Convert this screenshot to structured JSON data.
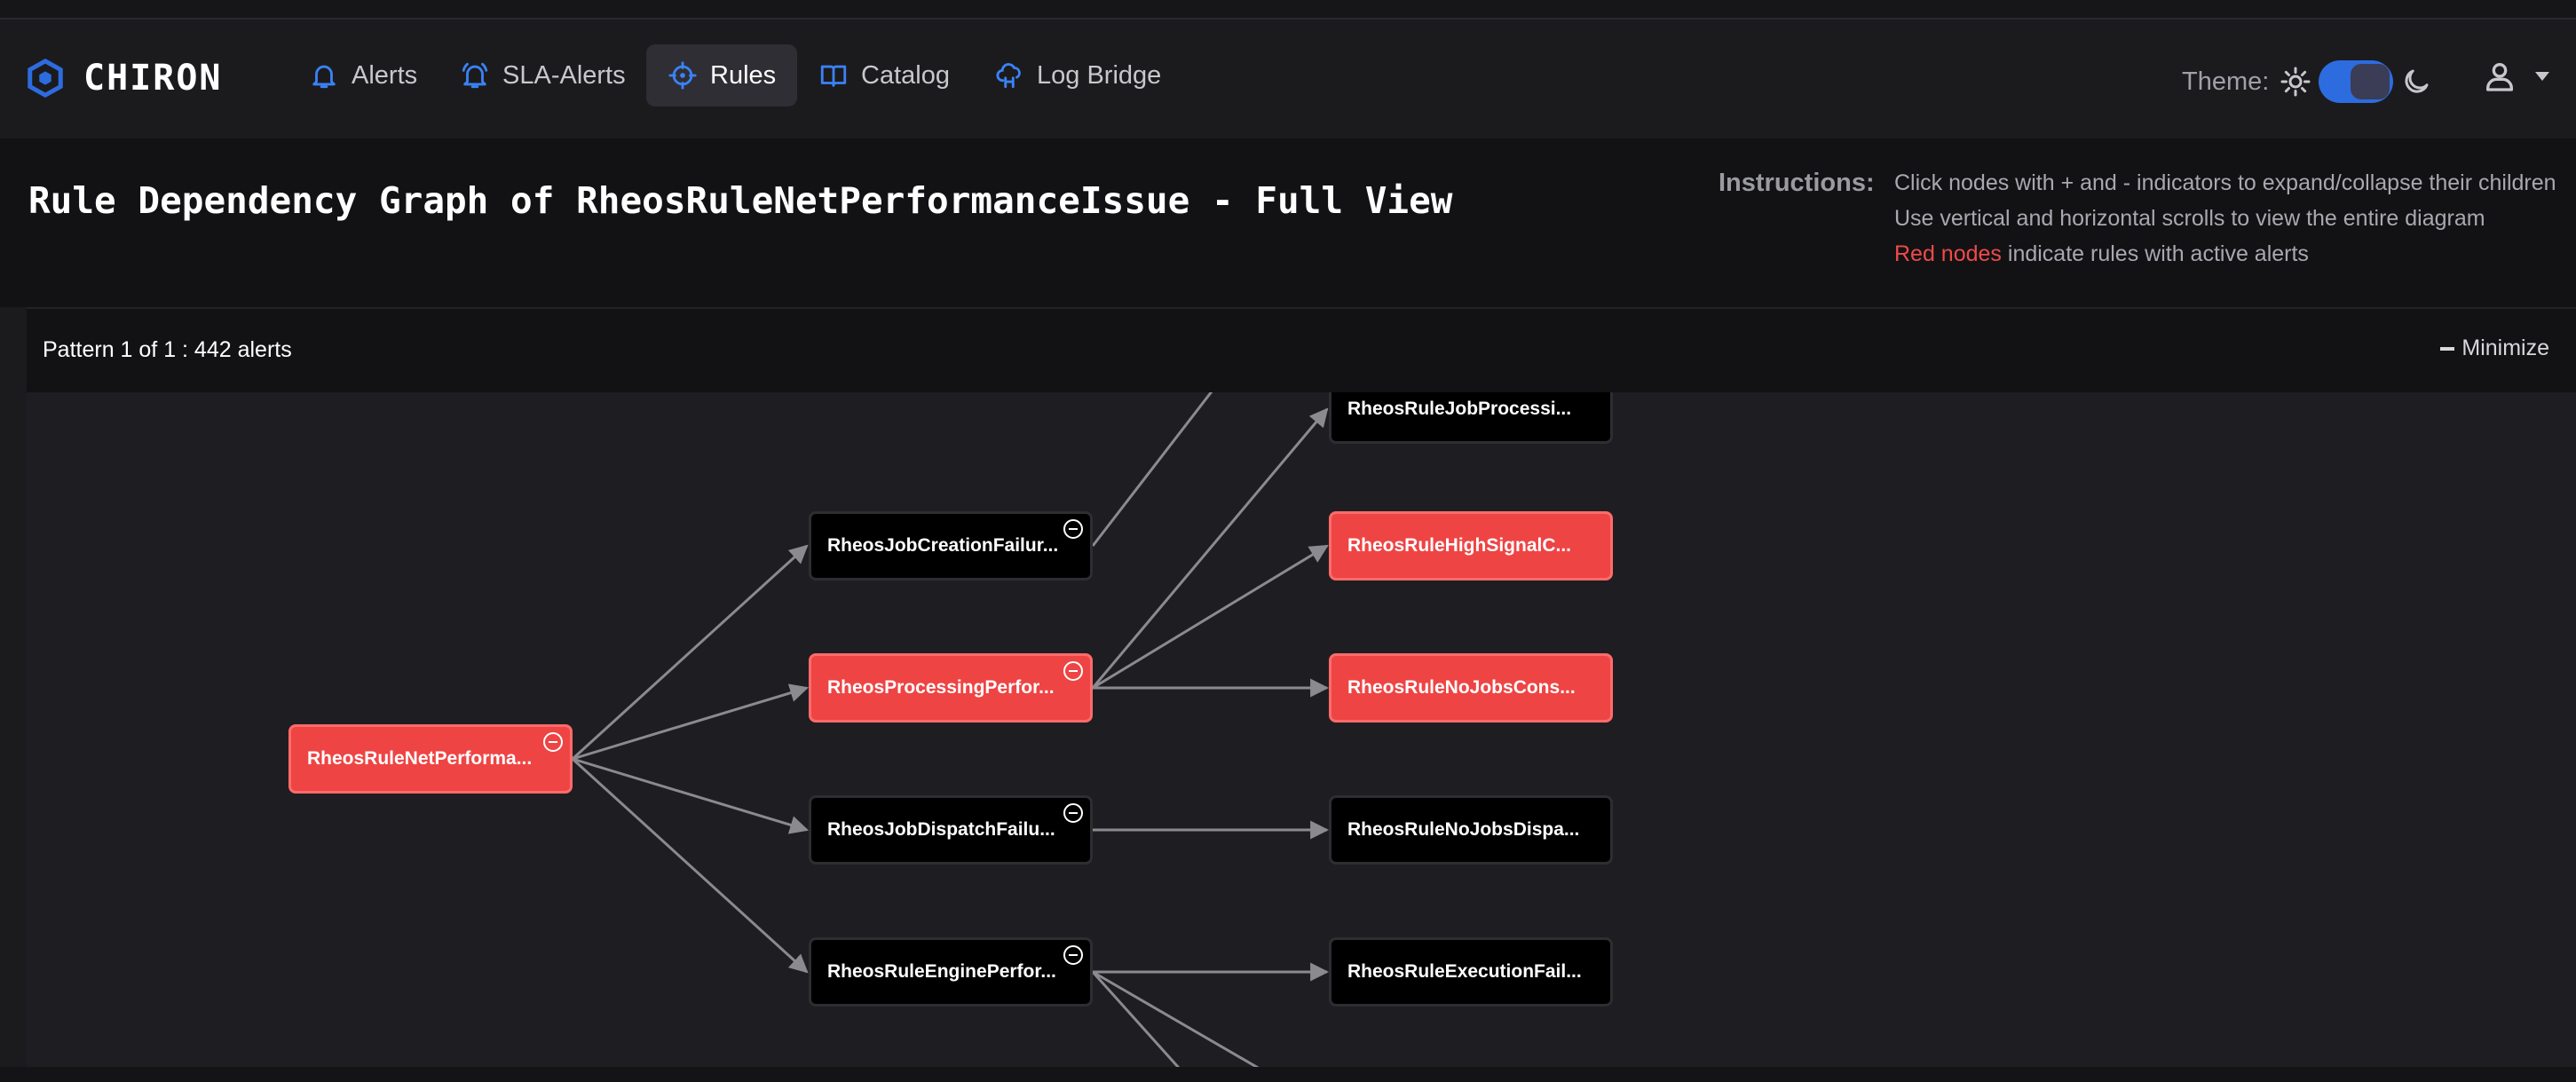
{
  "app": {
    "name": "CHIRON",
    "brand_color": "#2d6cdf",
    "alert_color": "#ef4444"
  },
  "nav": {
    "items": [
      {
        "label": "Alerts",
        "icon": "bell-icon"
      },
      {
        "label": "SLA-Alerts",
        "icon": "bell-ring-icon"
      },
      {
        "label": "Rules",
        "icon": "crosshair-icon",
        "active": true
      },
      {
        "label": "Catalog",
        "icon": "book-icon"
      },
      {
        "label": "Log Bridge",
        "icon": "cloud-link-icon"
      }
    ],
    "theme_label": "Theme:",
    "theme_dark": true
  },
  "page": {
    "title": "Rule Dependency Graph of RheosRuleNetPerformanceIssue - Full View",
    "instructions_label": "Instructions:",
    "instructions": [
      "Click nodes with + and - indicators to expand/collapse their children",
      "Use vertical and horizontal scrolls to view the entire diagram",
      "indicate rules with active alerts"
    ],
    "red_nodes_text": "Red nodes"
  },
  "pattern": {
    "text": "Pattern 1 of 1 : 442 alerts",
    "minimize_label": "Minimize"
  },
  "graph": {
    "nodes": [
      {
        "id": "root",
        "label": "RheosRuleNetPerforma...",
        "alert": true,
        "expanded": true
      },
      {
        "id": "job_creation",
        "label": "RheosJobCreationFailur...",
        "alert": false,
        "expanded": true
      },
      {
        "id": "processing",
        "label": "RheosProcessingPerfor...",
        "alert": true,
        "expanded": true
      },
      {
        "id": "job_dispatch",
        "label": "RheosJobDispatchFailu...",
        "alert": false,
        "expanded": true
      },
      {
        "id": "rule_engine",
        "label": "RheosRuleEnginePerfor...",
        "alert": false,
        "expanded": true
      },
      {
        "id": "job_processing",
        "label": "RheosRuleJobProcessi...",
        "alert": false
      },
      {
        "id": "high_signal",
        "label": "RheosRuleHighSignalC...",
        "alert": true
      },
      {
        "id": "no_jobs_cons",
        "label": "RheosRuleNoJobsCons...",
        "alert": true
      },
      {
        "id": "no_jobs_dispa",
        "label": "RheosRuleNoJobsDispa...",
        "alert": false
      },
      {
        "id": "execution_fail",
        "label": "RheosRuleExecutionFail...",
        "alert": false
      }
    ]
  }
}
